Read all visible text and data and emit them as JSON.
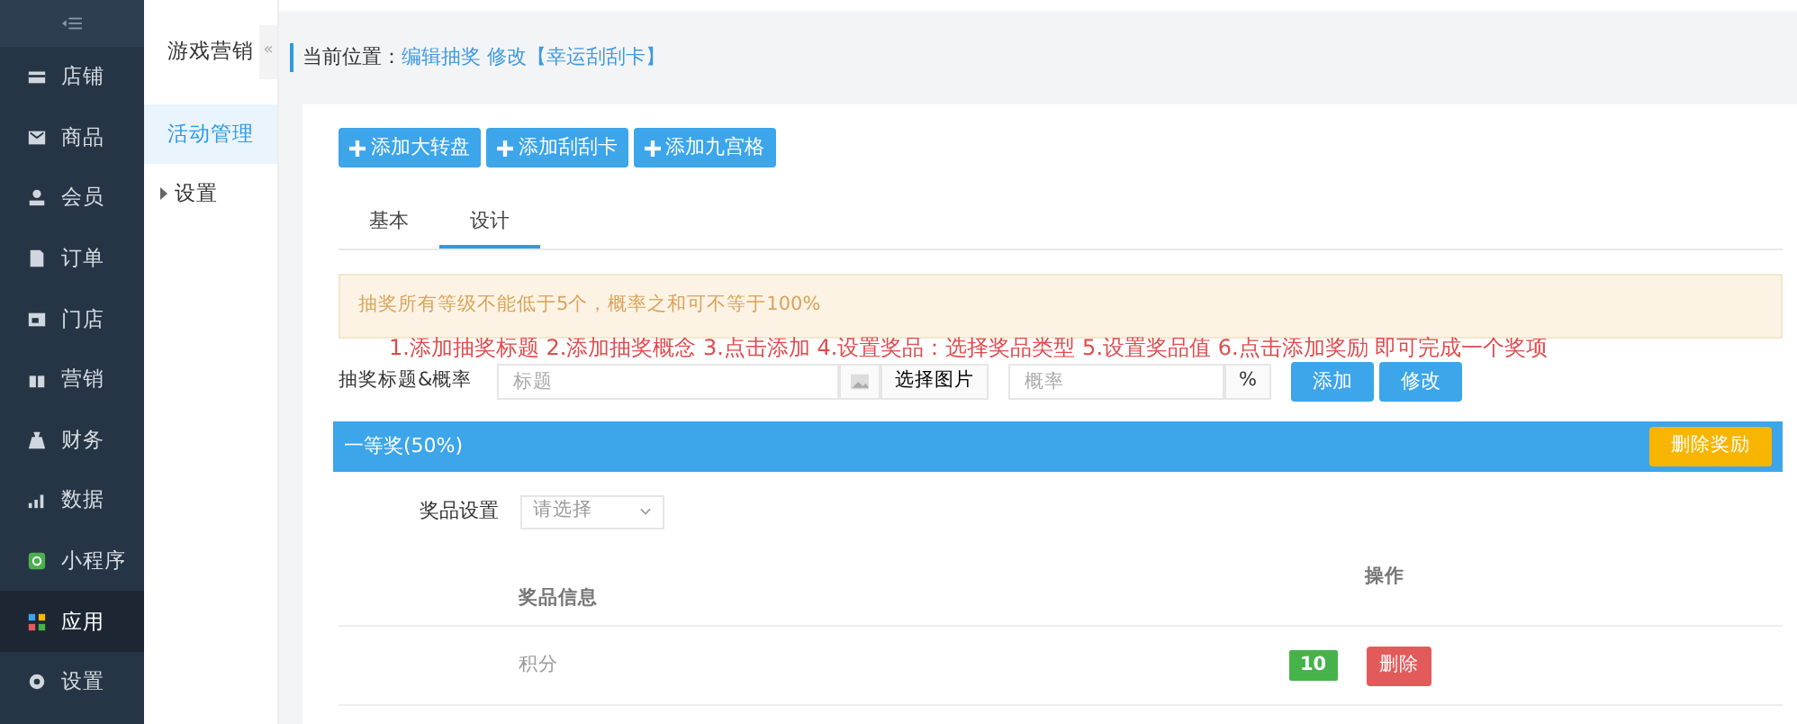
{
  "nav": [
    {
      "label": "店铺",
      "selected": false
    },
    {
      "label": "商品",
      "selected": false
    },
    {
      "label": "会员",
      "selected": false
    },
    {
      "label": "订单",
      "selected": false
    },
    {
      "label": "门店",
      "selected": false
    },
    {
      "label": "营销",
      "selected": false
    },
    {
      "label": "财务",
      "selected": false
    },
    {
      "label": "数据",
      "selected": false
    },
    {
      "label": "小程序",
      "selected": false
    },
    {
      "label": "应用",
      "selected": true
    },
    {
      "label": "设置",
      "selected": false
    }
  ],
  "subnav": {
    "title": "游戏营销",
    "collapse": "«",
    "items": [
      {
        "label": "活动管理",
        "kind": "link",
        "selected": true
      },
      {
        "label": "设置",
        "kind": "group",
        "selected": false
      }
    ]
  },
  "breadcrumb": {
    "label": "当前位置：",
    "path": "编辑抽奖 修改【幸运刮刮卡】"
  },
  "add_buttons": [
    "添加大转盘",
    "添加刮刮卡",
    "添加九宫格"
  ],
  "tabs": [
    {
      "label": "基本",
      "selected": false
    },
    {
      "label": "设计",
      "selected": true
    }
  ],
  "alert": "抽奖所有等级不能低于5个，概率之和可不等于100%",
  "instruction": "1.添加抽奖标题 2.添加抽奖概念 3.点击添加 4.设置奖品：选择奖品类型 5.设置奖品值 6.点击添加奖励 即可完成一个奖项",
  "form": {
    "label": "抽奖标题&概率",
    "title_placeholder": "标题",
    "image_button": "选择图片",
    "rate_placeholder": "概率",
    "rate_unit": "%",
    "buttons": [
      "添加",
      "修改"
    ]
  },
  "prize": {
    "title": "一等奖(50%)",
    "delete_button": "删除奖励",
    "setting_label": "奖品设置",
    "select_placeholder": "请选择",
    "columns": [
      "奖品信息",
      "操作"
    ],
    "rows": [
      {
        "name": "积分",
        "value": "10",
        "action": "删除"
      }
    ]
  }
}
